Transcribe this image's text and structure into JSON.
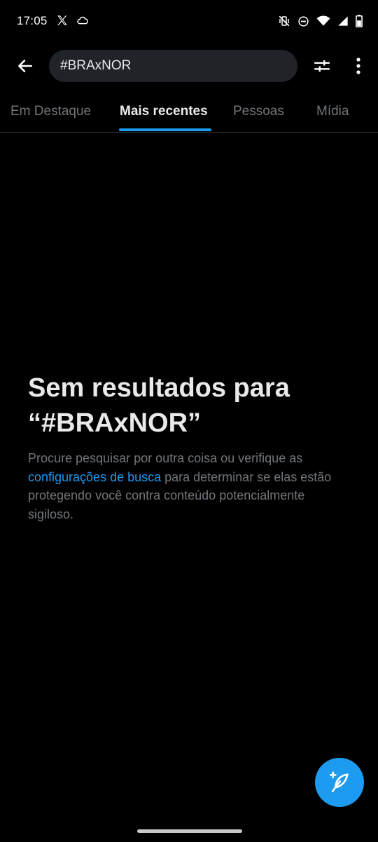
{
  "status_bar": {
    "time": "17:05",
    "left_icons": [
      "x-logo-icon",
      "cloud-icon"
    ],
    "right_icons": [
      "vibrate-mute-icon",
      "do-not-disturb-icon",
      "wifi-icon",
      "signal-icon",
      "battery-icon"
    ]
  },
  "search": {
    "query": "#BRAxNOR"
  },
  "tabs": [
    {
      "label": "Em Destaque",
      "active": false
    },
    {
      "label": "Mais recentes",
      "active": true
    },
    {
      "label": "Pessoas",
      "active": false
    },
    {
      "label": "Mídia",
      "active": false
    }
  ],
  "empty_state": {
    "title": "Sem resultados para “#BRAxNOR”",
    "desc_before": "Procure pesquisar por outra coisa ou verifique as ",
    "desc_link": "configurações de busca",
    "desc_after": " para determinar se elas estão protegendo você contra conteúdo potencialmente sigiloso."
  },
  "colors": {
    "background": "#000000",
    "accent": "#1d9bf0",
    "text_primary": "#e7e9ea",
    "text_secondary": "#71767b",
    "search_bg": "#202327"
  }
}
